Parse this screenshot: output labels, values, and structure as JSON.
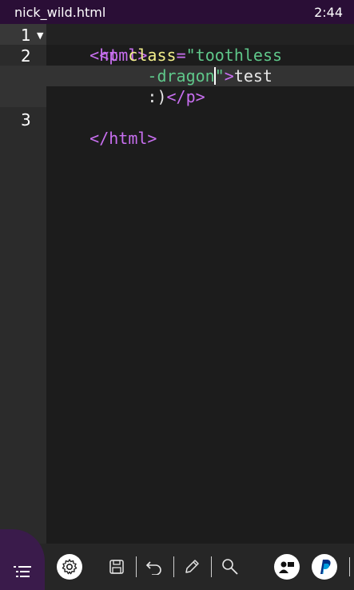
{
  "status_bar": {
    "filename": "nick_wild.html",
    "time": "2:44"
  },
  "gutter": {
    "line_numbers": [
      "1",
      "2",
      "3"
    ]
  },
  "code": {
    "l1_tag": "<html>",
    "l2_indent": "     ",
    "l2_open": "<p ",
    "l2_attr": "class",
    "l2_eq": "=",
    "l2_str1": "\"toothless",
    "l2b_indent": "          ",
    "l2b_str2": "-dragon",
    "l2b_str3": "\"",
    "l2b_close": ">",
    "l2b_text": "test",
    "l2c_indent": "          ",
    "l2c_text": ":)",
    "l2c_tag": "</p>",
    "l3_tag": "</html>"
  },
  "toolbar": {
    "icons": [
      "list-icon",
      "settings-icon",
      "save-icon",
      "undo-icon",
      "edit-icon",
      "search-icon",
      "share-icon",
      "paypal-icon"
    ]
  },
  "colors": {
    "title_bg": "#2a0e36",
    "accent": "#3a1b4b",
    "tag": "#c86ff0",
    "attr": "#f2ee8a",
    "string": "#5fc78a"
  }
}
